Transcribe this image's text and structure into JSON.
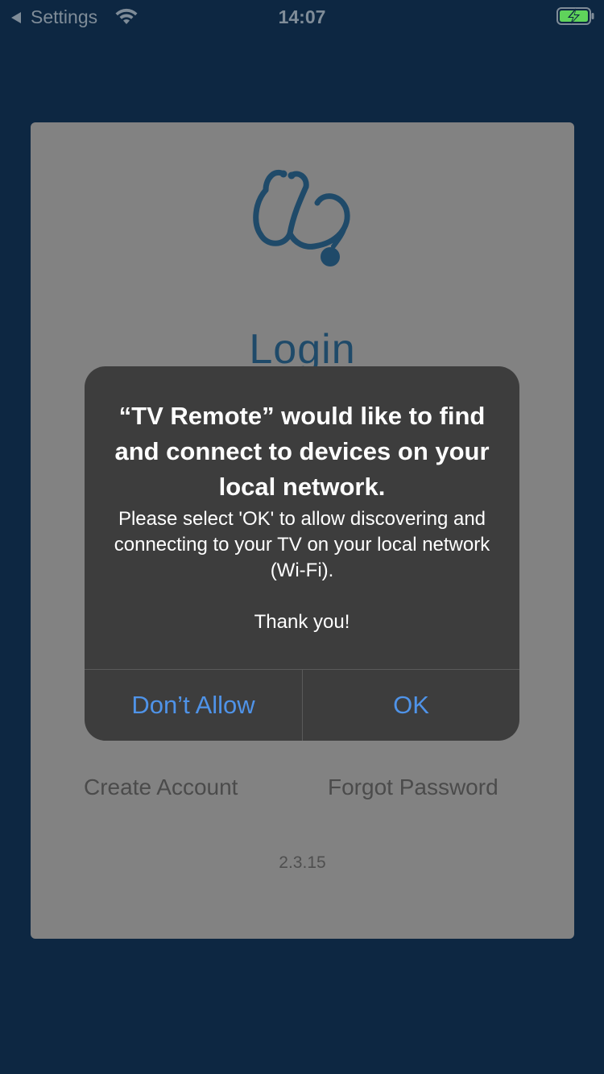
{
  "status_bar": {
    "back_label": "Settings",
    "time": "14:07",
    "icons": [
      "back-arrow-icon",
      "wifi-icon",
      "battery-charging-icon"
    ]
  },
  "login_screen": {
    "logo_icon": "stethoscope-icon",
    "title": "Login",
    "create_account_label": "Create Account",
    "forgot_password_label": "Forgot Password",
    "version": "2.3.15"
  },
  "alert": {
    "title": "“TV Remote” would like to find and connect to devices on your local network.",
    "message": "Please select 'OK' to allow discovering and connecting to your TV on your local network (Wi-Fi).\n\nThank you!",
    "buttons": {
      "deny_label": "Don’t Allow",
      "allow_label": "OK"
    }
  },
  "colors": {
    "background": "#0d2742",
    "card": "#828282",
    "brand": "#1f4a69",
    "alert_background": "#3d3d3d",
    "alert_button": "#4f93e8",
    "battery_green": "#5fd35b"
  }
}
